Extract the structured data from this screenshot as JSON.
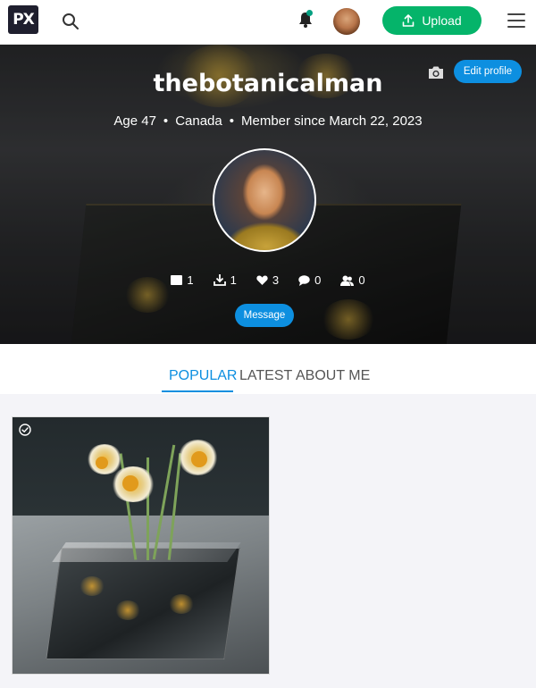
{
  "nav": {
    "logo_text": "PX",
    "upload_label": "Upload"
  },
  "profile": {
    "username": "thebotanicalman",
    "age": "Age 47",
    "country": "Canada",
    "member_since": "Member since March 22, 2023",
    "edit_label": "Edit profile",
    "message_label": "Message",
    "stats": [
      {
        "icon": "image-icon",
        "value": "1"
      },
      {
        "icon": "download-icon",
        "value": "1"
      },
      {
        "icon": "heart-icon",
        "value": "3"
      },
      {
        "icon": "comment-icon",
        "value": "0"
      },
      {
        "icon": "followers-icon",
        "value": "0"
      }
    ]
  },
  "tabs": [
    {
      "label": "POPULAR",
      "active": true
    },
    {
      "label": "LATEST",
      "active": false
    },
    {
      "label": "ABOUT ME",
      "active": false
    }
  ],
  "colors": {
    "accent": "#0d8fe0",
    "upload": "#05b46a",
    "notification_dot": "#05a081"
  }
}
